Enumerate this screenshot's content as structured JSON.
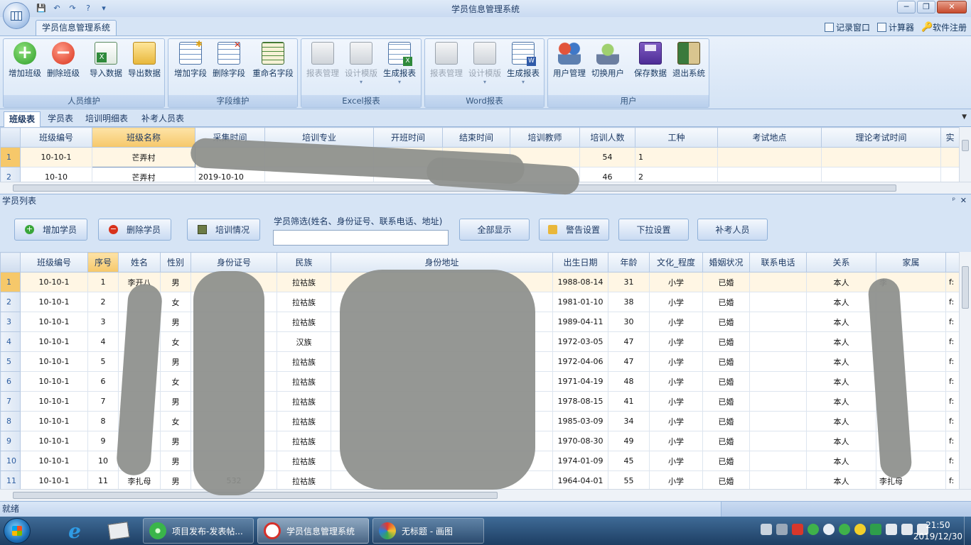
{
  "window": {
    "title": "学员信息管理系统",
    "minimize": "─",
    "maximize": "❐",
    "close": "✕"
  },
  "qat": [
    "💾",
    "↶",
    "↷",
    "?",
    "▾"
  ],
  "ribbon": {
    "tab": "学员信息管理系统",
    "right_tools": [
      "记录窗口",
      "计算器",
      "软件注册"
    ],
    "groups": [
      {
        "caption": "人员维护",
        "buttons": [
          "增加班级",
          "删除班级",
          "导入数据",
          "导出数据"
        ]
      },
      {
        "caption": "字段维护",
        "buttons": [
          "增加字段",
          "删除字段",
          "重命名字段"
        ]
      },
      {
        "caption": "Excel报表",
        "buttons": [
          "报表管理",
          "设计模版",
          "生成报表"
        ]
      },
      {
        "caption": "Word报表",
        "buttons": [
          "报表管理",
          "设计模版",
          "生成报表"
        ]
      },
      {
        "caption": "用户",
        "buttons": [
          "用户管理",
          "切换用户",
          "保存数据",
          "退出系统"
        ]
      }
    ]
  },
  "sheet_tabs": [
    "班级表",
    "学员表",
    "培训明细表",
    "补考人员表"
  ],
  "class_table": {
    "headers": [
      "班级编号",
      "班级名称",
      "采集时间",
      "培训专业",
      "开班时间",
      "结束时间",
      "培训教师",
      "培训人数",
      "工种",
      "考试地点",
      "理论考试时间",
      "实"
    ],
    "rows": [
      [
        "1",
        "10-10-1",
        "芒弄村",
        "",
        "",
        "",
        "",
        "",
        "54",
        "1",
        "",
        "",
        ""
      ],
      [
        "2",
        "10-10",
        "芒弄村",
        "2019-10-10",
        "",
        "",
        "",
        "",
        "46",
        "2",
        "",
        "",
        ""
      ]
    ]
  },
  "student_panel": {
    "caption": "学员列表",
    "pin": "ᵖ",
    "close": "✕",
    "buttons": [
      "增加学员",
      "删除学员",
      "培训情况",
      "全部显示",
      "警告设置",
      "下拉设置",
      "补考人员"
    ],
    "filter_label": "学员筛选(姓名、身份证号、联系电话、地址)",
    "filter_value": ""
  },
  "student_table": {
    "headers": [
      "班级编号",
      "序号",
      "姓名",
      "性别",
      "身份证号",
      "民族",
      "身份地址",
      "出生日期",
      "年龄",
      "文化_程度",
      "婚姻状况",
      "联系电话",
      "关系",
      "家属"
    ],
    "rows": [
      [
        "1",
        "10-10-1",
        "1",
        "李开八",
        "男",
        "",
        "拉祜族",
        "",
        "1988-08-14",
        "31",
        "小学",
        "已婚",
        "",
        "本人",
        "李",
        "f:"
      ],
      [
        "2",
        "10-10-1",
        "2",
        "",
        "女",
        "",
        "拉祜族",
        "",
        "1981-01-10",
        "38",
        "小学",
        "已婚",
        "",
        "本人",
        "",
        "f:"
      ],
      [
        "3",
        "10-10-1",
        "3",
        "",
        "男",
        "",
        "拉祜族",
        "",
        "1989-04-11",
        "30",
        "小学",
        "已婚",
        "",
        "本人",
        "",
        "f:"
      ],
      [
        "4",
        "10-10-1",
        "4",
        "",
        "女",
        "",
        "汉族",
        "",
        "1972-03-05",
        "47",
        "小学",
        "已婚",
        "",
        "本人",
        "",
        "f:"
      ],
      [
        "5",
        "10-10-1",
        "5",
        "",
        "男",
        "",
        "拉祜族",
        "",
        "1972-04-06",
        "47",
        "小学",
        "已婚",
        "",
        "本人",
        "",
        "f:"
      ],
      [
        "6",
        "10-10-1",
        "6",
        "",
        "女",
        "",
        "拉祜族",
        "",
        "1971-04-19",
        "48",
        "小学",
        "已婚",
        "",
        "本人",
        "",
        "f:"
      ],
      [
        "7",
        "10-10-1",
        "7",
        "",
        "男",
        "",
        "拉祜族",
        "",
        "1978-08-15",
        "41",
        "小学",
        "已婚",
        "",
        "本人",
        "",
        "f:"
      ],
      [
        "8",
        "10-10-1",
        "8",
        "",
        "女",
        "",
        "拉祜族",
        "",
        "1985-03-09",
        "34",
        "小学",
        "已婚",
        "",
        "本人",
        "",
        "f:"
      ],
      [
        "9",
        "10-10-1",
        "9",
        "",
        "男",
        "",
        "拉祜族",
        "",
        "1970-08-30",
        "49",
        "小学",
        "已婚",
        "",
        "本人",
        "",
        "f:"
      ],
      [
        "10",
        "10-10-1",
        "10",
        "",
        "男",
        "",
        "拉祜族",
        "",
        "1974-01-09",
        "45",
        "小学",
        "已婚",
        "",
        "本人",
        "",
        "f:"
      ],
      [
        "11",
        "10-10-1",
        "11",
        "李扎母",
        "男",
        "532",
        "拉祜族",
        "",
        "1964-04-01",
        "55",
        "小学",
        "已婚",
        "",
        "本人",
        "李扎母",
        "f:"
      ]
    ]
  },
  "status": {
    "text": "就绪"
  },
  "taskbar": {
    "tasks": [
      "项目发布-发表帖...",
      "学员信息管理系统",
      "无标题 - 画图"
    ],
    "time": "21:50",
    "date": "2019/12/30"
  },
  "colors": {
    "accent": "#f6c86a",
    "ribbon": "#d6e4f5",
    "taskbar": "#1d3e63"
  }
}
